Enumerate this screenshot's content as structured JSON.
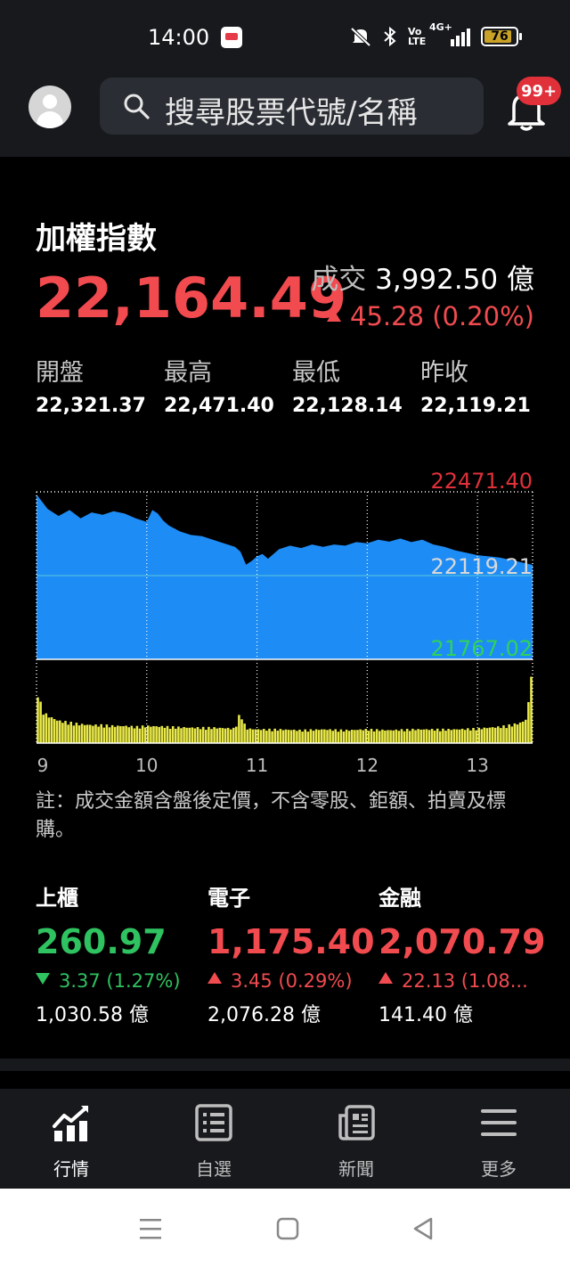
{
  "status_bar": {
    "time": "14:00",
    "battery": "76"
  },
  "header": {
    "search_placeholder": "搜尋股票代號/名稱",
    "notification_badge": "99+"
  },
  "index": {
    "title": "加權指數",
    "value": "22,164.49",
    "volume_label": "成交",
    "volume_value": "3,992.50 億",
    "change": "45.28 (0.20%)",
    "direction": "up",
    "ohlc": [
      {
        "label": "開盤",
        "value": "22,321.37"
      },
      {
        "label": "最高",
        "value": "22,471.40"
      },
      {
        "label": "最低",
        "value": "22,128.14"
      },
      {
        "label": "昨收",
        "value": "22,119.21"
      }
    ]
  },
  "chart_data": {
    "type": "area",
    "price_axis_labels": {
      "high": "22471.40",
      "ref": "22119.21",
      "low": "21767.02"
    },
    "ylim": [
      21767.02,
      22471.4
    ],
    "reference": 22119.21,
    "x_ticks": [
      "9",
      "10",
      "11",
      "12",
      "13"
    ],
    "x_tick_times": [
      9.0,
      10.0,
      11.0,
      12.0,
      13.0
    ],
    "x_range": [
      9.0,
      13.5
    ],
    "price_series": {
      "x": [
        9.0,
        9.05,
        9.1,
        9.2,
        9.3,
        9.4,
        9.5,
        9.6,
        9.7,
        9.8,
        9.9,
        10.0,
        10.05,
        10.1,
        10.15,
        10.2,
        10.3,
        10.4,
        10.5,
        10.6,
        10.7,
        10.8,
        10.85,
        10.9,
        10.95,
        11.0,
        11.05,
        11.1,
        11.2,
        11.3,
        11.4,
        11.5,
        11.6,
        11.7,
        11.8,
        11.9,
        12.0,
        12.1,
        12.2,
        12.3,
        12.4,
        12.5,
        12.6,
        12.7,
        12.8,
        12.9,
        13.0,
        13.1,
        13.2,
        13.3,
        13.4,
        13.5
      ],
      "values": [
        22460,
        22430,
        22400,
        22370,
        22395,
        22360,
        22385,
        22375,
        22390,
        22380,
        22360,
        22345,
        22395,
        22380,
        22350,
        22330,
        22305,
        22290,
        22285,
        22270,
        22255,
        22240,
        22220,
        22165,
        22180,
        22200,
        22210,
        22190,
        22230,
        22245,
        22235,
        22250,
        22240,
        22250,
        22245,
        22260,
        22255,
        22270,
        22262,
        22275,
        22260,
        22270,
        22250,
        22240,
        22225,
        22215,
        22205,
        22200,
        22195,
        22185,
        22175,
        22164
      ]
    },
    "volume_series": {
      "x": [
        9.0,
        9.05,
        9.1,
        9.2,
        9.3,
        9.4,
        9.5,
        9.6,
        9.7,
        9.8,
        9.9,
        10.0,
        10.2,
        10.4,
        10.6,
        10.8,
        10.85,
        10.9,
        11.0,
        11.2,
        11.4,
        11.6,
        11.8,
        12.0,
        12.2,
        12.4,
        12.6,
        12.8,
        13.0,
        13.1,
        13.2,
        13.3,
        13.4,
        13.45,
        13.5
      ],
      "values": [
        0.7,
        0.38,
        0.32,
        0.26,
        0.24,
        0.22,
        0.21,
        0.21,
        0.2,
        0.2,
        0.19,
        0.2,
        0.19,
        0.18,
        0.18,
        0.17,
        0.36,
        0.17,
        0.16,
        0.16,
        0.15,
        0.16,
        0.15,
        0.16,
        0.15,
        0.16,
        0.16,
        0.16,
        0.17,
        0.18,
        0.19,
        0.21,
        0.24,
        0.29,
        1.0
      ]
    },
    "colors": {
      "area": "#1e8cf5",
      "volume": "#e8e84a",
      "high": "#e0303a",
      "ref": "#d8d8d8",
      "low": "#2fd25a"
    }
  },
  "note": "註：成交金額含盤後定價，不含零股、鉅額、拍賣及標購。",
  "sub_indices": [
    {
      "name": "上櫃",
      "value": "260.97",
      "direction": "down",
      "change": "3.37 (1.27%)",
      "amount": "1,030.58 億"
    },
    {
      "name": "電子",
      "value": "1,175.40",
      "direction": "up",
      "change": "3.45 (0.29%)",
      "amount": "2,076.28 億"
    },
    {
      "name": "金融",
      "value": "2,070.79",
      "direction": "up",
      "change": "22.13 (1.08...",
      "amount": "141.40 億"
    }
  ],
  "bottom_nav": [
    {
      "label": "行情",
      "icon": "chart-icon",
      "active": true
    },
    {
      "label": "自選",
      "icon": "list-icon",
      "active": false
    },
    {
      "label": "新聞",
      "icon": "news-icon",
      "active": false
    },
    {
      "label": "更多",
      "icon": "menu-icon",
      "active": false
    }
  ],
  "colors": {
    "up": "#f14b50",
    "down": "#2fc260",
    "background": "#000000",
    "panel": "#17191d"
  }
}
